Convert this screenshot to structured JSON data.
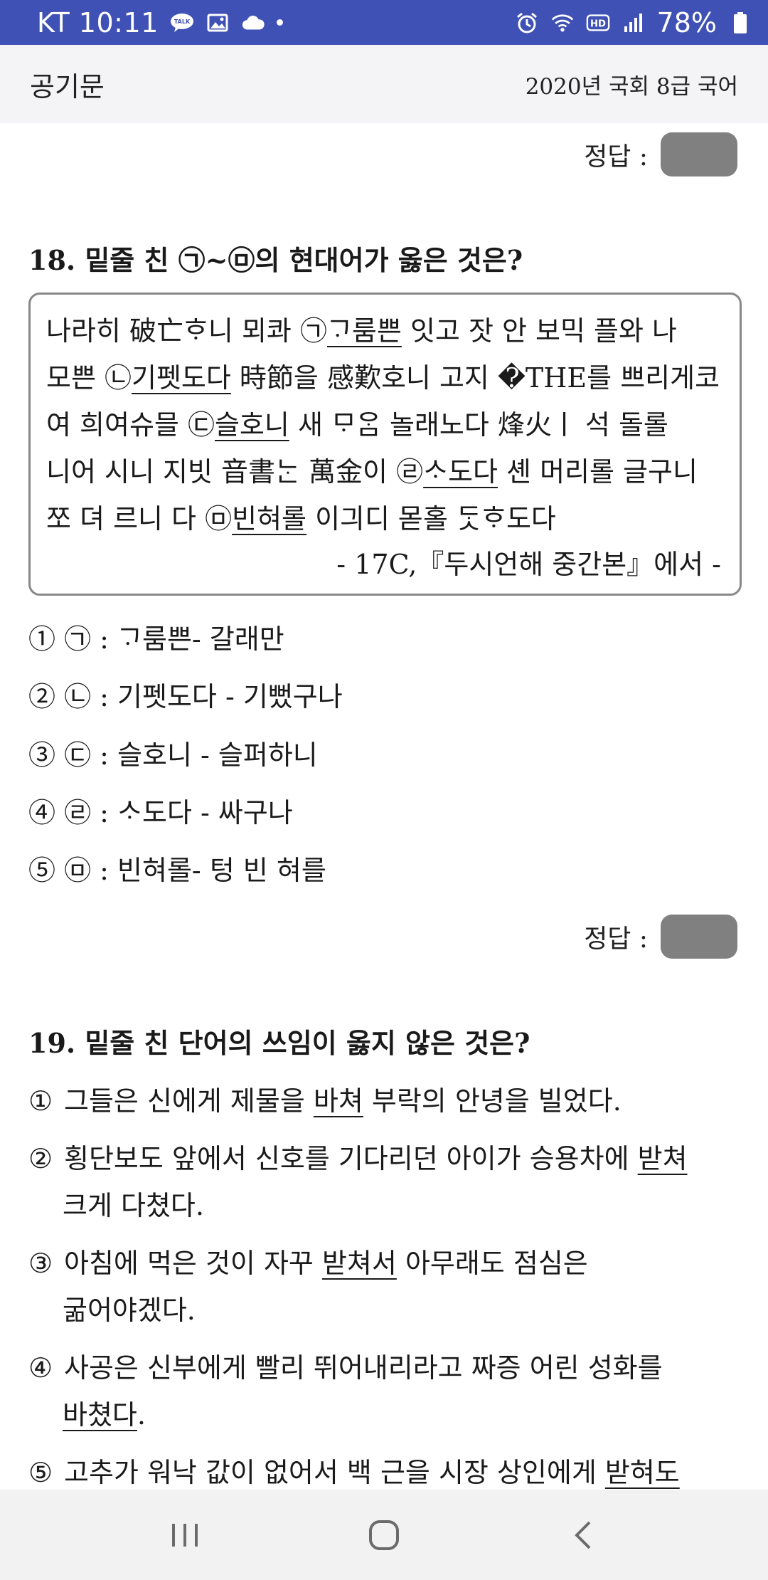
{
  "status_bar": {
    "carrier": "KT",
    "time": "10:11",
    "battery": "78%",
    "left_icons": [
      "talk-icon",
      "image-icon",
      "cloud-icon",
      "dot-icon"
    ],
    "right_icons": [
      "alarm-icon",
      "wifi-icon",
      "hd-icon",
      "signal-icon",
      "battery-icon"
    ]
  },
  "app_bar": {
    "title": "공기문",
    "exam": "2020년 국회 8급 국어"
  },
  "answer_label": "정답 :",
  "q18": {
    "title": "18. 밑줄 친 ㉠~㉤의 현대어가 옳은 것은?",
    "passage": {
      "l1a": "나라히 破亡ᄒᆞ니 뫼콰 ㉠",
      "l1u": "ᄀᆞ룸쁜",
      "l1b": " 잇고 잣 안 보믹 플와 나",
      "l2a": "모쁜 ㉡",
      "l2u": "기펫도다",
      "l2b": " 時節을 感歎호니 고지 �THE를 쁘리게코",
      "l3a": "여 희여슈믈 ㉢",
      "l3u": "슬호니",
      "l3b": " 새 ᄆᆞᄋᆞᆷ 놀래노다 烽火ㅣ 석 돌롤",
      "l4a": "니어 시니 지빗 音書ᄂᆞᆫ 萬金이 ㉣",
      "l4u": "ᄉᆞ도다",
      "l4b": " 셴 머리롤 글구니",
      "l5a": "쪼 뎌 르니 다 ㉤",
      "l5u": "빈혀롤",
      "l5b": " 이긔디 몯홀 ᄃᆞᆺᄒᆞ도다",
      "source": "- 17C,『두시언해 중간본』에서 -"
    },
    "options": [
      "① ㉠ : ᄀᆞ룸쁜- 갈래만",
      "② ㉡ : 기펫도다 - 기뻤구나",
      "③ ㉢ : 슬호니 - 슬퍼하니",
      "④ ㉣ : ᄉᆞ도다 - 싸구나",
      "⑤ ㉤ : 빈혀롤- 텅 빈 혀를"
    ]
  },
  "q19": {
    "title": "19. 밑줄 친 단어의 쓰임이 옳지 않은 것은?",
    "options": [
      {
        "num": "①",
        "a": "그들은 신에게 제물을 ",
        "u": "바쳐",
        "b": " 부락의 안녕을 빌었다."
      },
      {
        "num": "②",
        "a": "횡단보도 앞에서 신호를 기다리던 아이가 승용차에 ",
        "u": "받쳐",
        "b": "",
        "cont": "크게 다쳤다."
      },
      {
        "num": "③",
        "a": "아침에 먹은 것이 자꾸 ",
        "u": "받쳐서",
        "b": " 아무래도 점심은",
        "cont": "굶어야겠다."
      },
      {
        "num": "④",
        "a": "사공은 신부에게 빨리 뛰어내리라고 짜증 어린 성화를",
        "u": "",
        "b": "",
        "cont_u": "바쳤다",
        "cont_b": "."
      },
      {
        "num": "⑤",
        "a": "고추가 워낙 값이 없어서 백 근을 시장 상인에게 ",
        "u": "받혀도",
        "b": ""
      }
    ]
  },
  "nav": {
    "icons": [
      "recent-apps-icon",
      "home-icon",
      "back-icon"
    ]
  }
}
